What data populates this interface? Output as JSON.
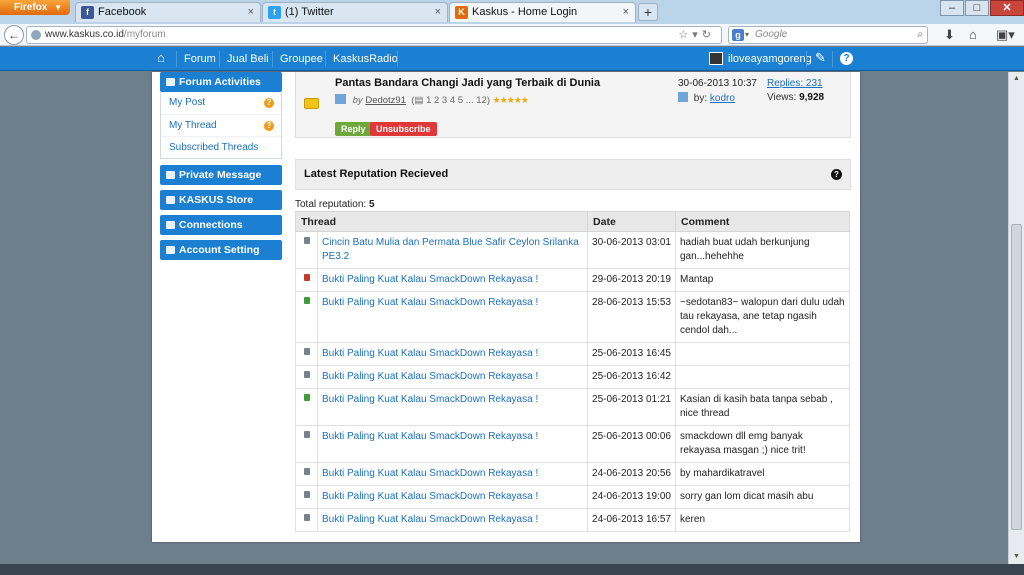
{
  "browser": {
    "menu_label": "Firefox",
    "tabs": [
      {
        "label": "Facebook",
        "icon": "facebook-icon",
        "color": "#3b5998"
      },
      {
        "label": "(1) Twitter",
        "icon": "twitter-icon",
        "color": "#2aa3ef"
      },
      {
        "label": "Kaskus - Home Login",
        "icon": "kaskus-icon",
        "color": "#e06a0c"
      }
    ],
    "url_host": "www.kaskus.co.id",
    "url_path": "/myforum",
    "search_placeholder": "Google"
  },
  "site": {
    "menu": [
      "Forum",
      "Jual Beli",
      "Groupee",
      "KaskusRadio"
    ],
    "username": "iloveayamgoreng"
  },
  "sidebar": {
    "forum_activities": "Forum Activities",
    "items": [
      {
        "label": "My Post",
        "badge": "?"
      },
      {
        "label": "My Thread",
        "badge": "?"
      },
      {
        "label": "Subscribed Threads",
        "badge": ""
      }
    ],
    "private_message": "Private Message",
    "store": "KASKUS Store",
    "connections": "Connections",
    "account_setting": "Account Setting"
  },
  "subscribed": {
    "title": "Pantas Bandara Changi Jadi yang Terbaik di Dunia",
    "by_label": "by",
    "author": "Dedotz91",
    "pages": "1 2 3 4 5 ... 12",
    "stars": "★★★★★",
    "reply_label": "Reply",
    "unsubscribe_label": "Unsubscribe",
    "date": "30-06-2013 10:37",
    "last_by_label": "by:",
    "last_by": "kodro",
    "replies": "Replies: 231",
    "views_label": "Views:",
    "views": "9,928"
  },
  "reputation": {
    "heading": "Latest Reputation Recieved",
    "total_label": "Total reputation:",
    "total": "5",
    "columns": [
      "Thread",
      "Date",
      "Comment"
    ],
    "rows": [
      {
        "color": "#7a7f8c",
        "thread": "Cincin Batu Mulia dan Permata Blue Safir Ceylon Srilanka PE3.2",
        "date": "30-06-2013 03:01",
        "comment": "hadiah buat udah berkunjung gan...hehehhe"
      },
      {
        "color": "#c23a2a",
        "thread": "Bukti Paling Kuat Kalau SmackDown Rekayasa !",
        "date": "29-06-2013 20:19",
        "comment": "Mantap"
      },
      {
        "color": "#3c9e3a",
        "thread": "Bukti Paling Kuat Kalau SmackDown Rekayasa !",
        "date": "28-06-2013 15:53",
        "comment": "~sedotan83~ walopun dari dulu udah tau rekayasa, ane tetap ngasih cendol dah..."
      },
      {
        "color": "#7a7f8c",
        "thread": "Bukti Paling Kuat Kalau SmackDown Rekayasa !",
        "date": "25-06-2013 16:45",
        "comment": ""
      },
      {
        "color": "#7a7f8c",
        "thread": "Bukti Paling Kuat Kalau SmackDown Rekayasa !",
        "date": "25-06-2013 16:42",
        "comment": ""
      },
      {
        "color": "#3c9e3a",
        "thread": "Bukti Paling Kuat Kalau SmackDown Rekayasa !",
        "date": "25-06-2013 01:21",
        "comment": "Kasian di kasih bata tanpa sebab , nice thread"
      },
      {
        "color": "#7a7f8c",
        "thread": "Bukti Paling Kuat Kalau SmackDown Rekayasa !",
        "date": "25-06-2013 00:06",
        "comment": "smackdown dll emg banyak rekayasa masgan ;) nice trit!"
      },
      {
        "color": "#7a7f8c",
        "thread": "Bukti Paling Kuat Kalau SmackDown Rekayasa !",
        "date": "24-06-2013 20:56",
        "comment": "by mahardikatravel"
      },
      {
        "color": "#7a7f8c",
        "thread": "Bukti Paling Kuat Kalau SmackDown Rekayasa !",
        "date": "24-06-2013 19:00",
        "comment": "sorry gan lom dicat masih abu"
      },
      {
        "color": "#7a7f8c",
        "thread": "Bukti Paling Kuat Kalau SmackDown Rekayasa !",
        "date": "24-06-2013 16:57",
        "comment": "keren"
      }
    ]
  }
}
